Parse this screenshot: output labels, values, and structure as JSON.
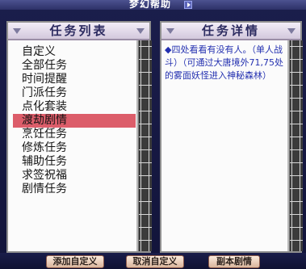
{
  "window": {
    "title": "梦幻帮助"
  },
  "task_list": {
    "header": "任务列表",
    "selected_index": 8,
    "items": [
      {
        "label": "自定义"
      },
      {
        "label": "全部任务"
      },
      {
        "label": "时间提醒"
      },
      {
        "label": "门派任务"
      },
      {
        "label": "点化套装"
      },
      {
        "label": "渡劫剧情"
      },
      {
        "label": "烹饪任务"
      },
      {
        "label": "修炼任务"
      },
      {
        "label": "辅助任务"
      },
      {
        "label": "求签祝福"
      },
      {
        "label": "剧情任务"
      }
    ]
  },
  "task_detail": {
    "header": "任务详情",
    "text": "◆四处看看有没有人。（单人战斗）（可通过大唐境外71,75处的雾面妖怪进入神秘森林）"
  },
  "buttons": {
    "add_custom": "添加自定义",
    "cancel_custom": "取消自定义",
    "dungeon_story": "副本剧情"
  },
  "colors": {
    "selected_row": "#dc5d6a",
    "detail_text": "#2330b0",
    "header_text": "#2c2b60"
  }
}
